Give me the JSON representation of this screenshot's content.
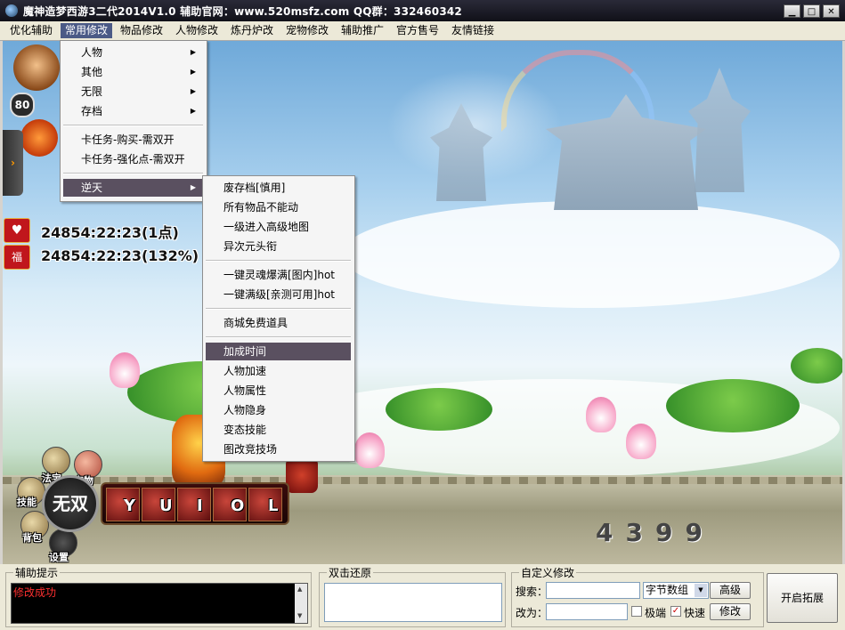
{
  "window": {
    "title": "魔神造梦西游3二代2014V1.0   辅助官网：www.520msfz.com   QQ群：332460342",
    "min_glyph": "▁",
    "max_glyph": "□",
    "close_glyph": "✕"
  },
  "menubar": [
    {
      "label": "优化辅助"
    },
    {
      "label": "常用修改"
    },
    {
      "label": "物品修改"
    },
    {
      "label": "人物修改"
    },
    {
      "label": "炼丹炉改"
    },
    {
      "label": "宠物修改"
    },
    {
      "label": "辅助推广"
    },
    {
      "label": "官方售号"
    },
    {
      "label": "友情链接"
    }
  ],
  "menu_main": {
    "group1": [
      "人物",
      "其他",
      "无限",
      "存档"
    ],
    "group2": [
      "卡任务-购买-需双开",
      "卡任务-强化点-需双开"
    ],
    "group3": [
      "逆天"
    ],
    "submenu_arrow": "▶"
  },
  "menu_sub": {
    "group1": [
      "废存档[慎用]",
      "所有物品不能动",
      "一级进入高级地图",
      "异次元头衔"
    ],
    "group2": [
      "一键灵魂爆满[图内]hot",
      "一键满级[亲测可用]hot"
    ],
    "group3": [
      "商城免费道具"
    ],
    "group4": [
      "加成时间",
      "人物加速",
      "人物属性",
      "人物隐身",
      "变态技能",
      "图改竞技场"
    ]
  },
  "game": {
    "level": "80",
    "side_tab_glyph": "›",
    "buff1_icon": "♥",
    "buff1_text": "24854:22:23(1点)",
    "buff2_icon": "福",
    "buff2_text": "24854:22:23(132%)",
    "wushuang": "无双",
    "skill_keys": [
      "Y",
      "U",
      "I",
      "O",
      "L"
    ],
    "round_buttons": {
      "fabao": "法宝",
      "chongwu": "宠物",
      "jineng": "技能",
      "beibao": "背包",
      "shezhi": "设置"
    },
    "stone_numbers": "4399"
  },
  "bottom": {
    "hint_title": "辅助提示",
    "hint_text": "修改成功",
    "scroll_up": "▲",
    "scroll_down": "▼",
    "restore_title": "双击还原",
    "custom_title": "自定义修改",
    "search_label": "搜索：",
    "search_value": "",
    "change_label": "改为：",
    "change_value": "",
    "type_value": "字节数组",
    "type_arrow": "▼",
    "advanced_btn": "高级",
    "modify_btn": "修改",
    "chk_extreme_label": "极端",
    "chk_extreme_mark": "",
    "chk_fast_label": "快速",
    "chk_fast_mark": "✓",
    "expand_btn": "开启拓展"
  },
  "colors": {
    "menu_highlight": "#4b5a86",
    "dropdown_highlight": "#5a5060",
    "hint_text": "#ff3030"
  }
}
